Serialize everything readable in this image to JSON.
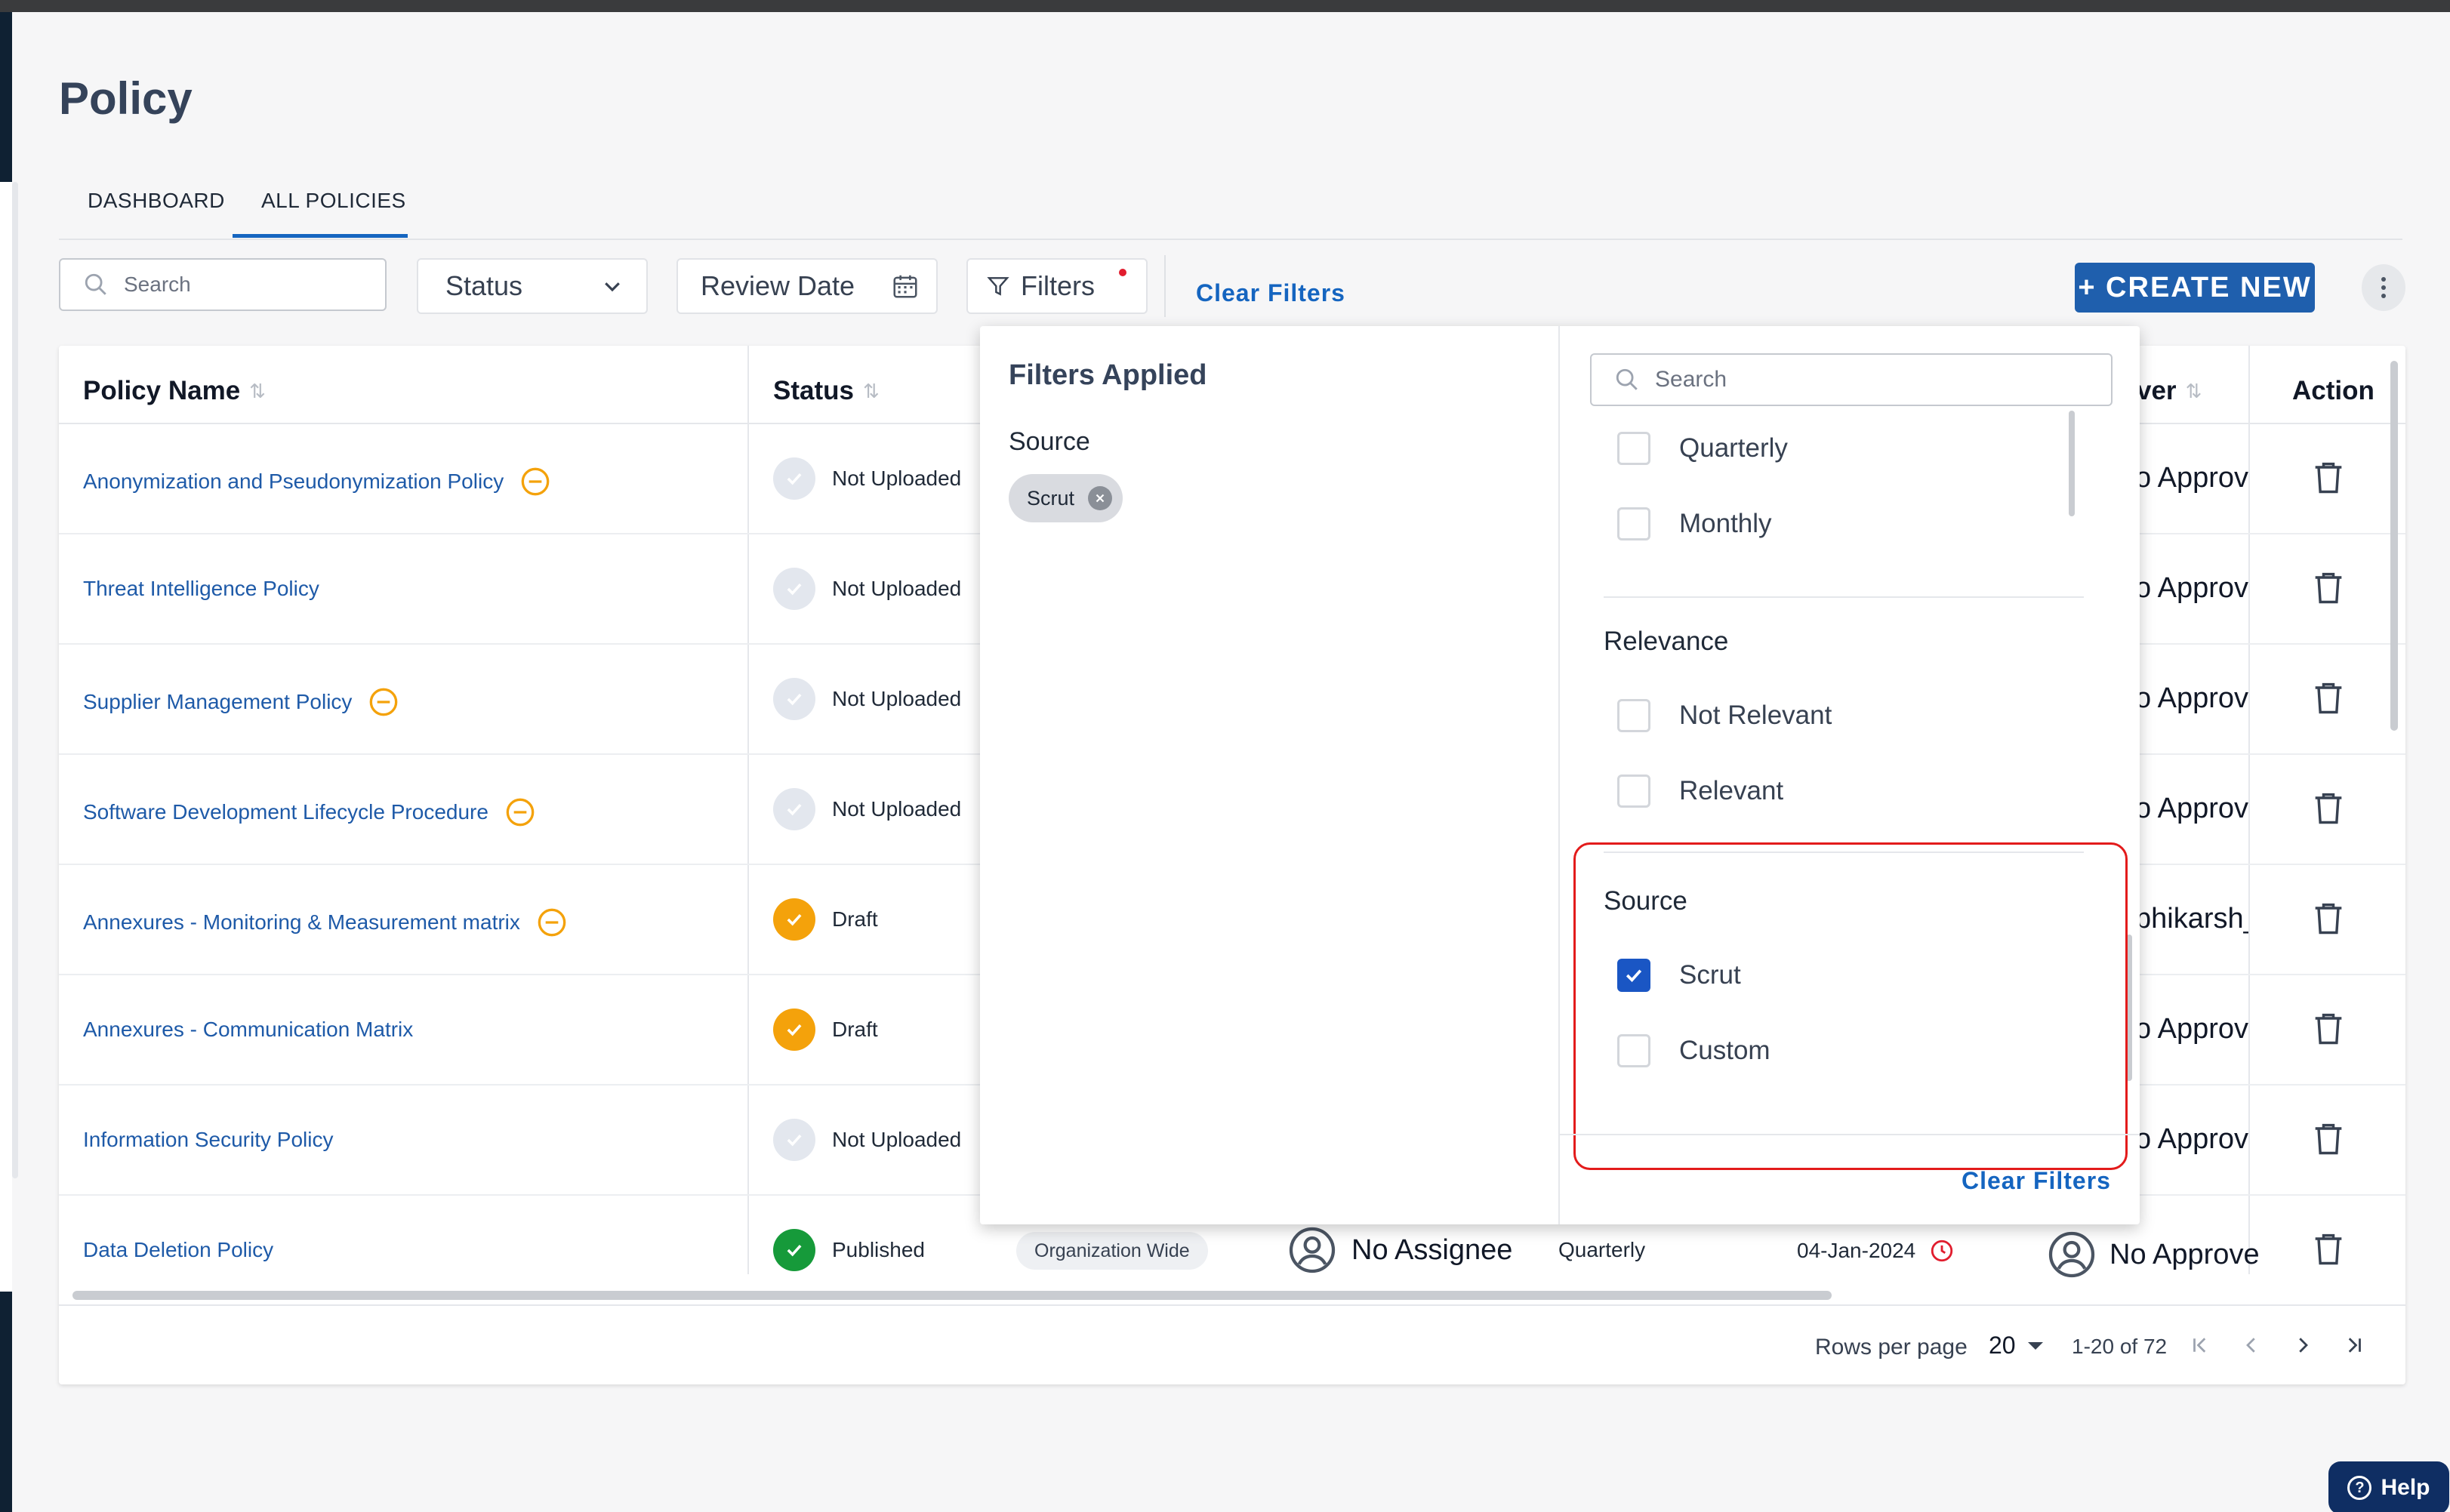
{
  "page": {
    "title": "Policy"
  },
  "tabs": [
    {
      "label": "DASHBOARD"
    },
    {
      "label": "ALL POLICIES"
    }
  ],
  "toolbar": {
    "search_placeholder": "Search",
    "status_label": "Status",
    "review_date_label": "Review Date",
    "filters_label": "Filters",
    "clear_filters_label": "Clear Filters",
    "create_label": "+ CREATE NEW"
  },
  "table": {
    "headers": {
      "policy_name": "Policy Name",
      "status": "Status",
      "approver": "ver",
      "action": "Action"
    },
    "rows": [
      {
        "name": "Anonymization and Pseudonymization Policy",
        "status": "Not Uploaded",
        "approver": "o Approve"
      },
      {
        "name": "Threat Intelligence Policy",
        "status": "Not Uploaded",
        "approver": "o Approve"
      },
      {
        "name": "Supplier Management Policy",
        "status": "Not Uploaded",
        "approver": "o Approve"
      },
      {
        "name": "Software Development Lifecycle Procedure",
        "status": "Not Uploaded",
        "approver": "o Approve"
      },
      {
        "name": "Annexures - Monitoring & Measurement matrix",
        "status": "Draft",
        "approver": "bhikarsh_s"
      },
      {
        "name": "Annexures - Communication Matrix",
        "status": "Draft",
        "approver": "o Approve"
      },
      {
        "name": "Information Security Policy",
        "status": "Not Uploaded",
        "approver": "o Approve"
      },
      {
        "name": "Data Deletion Policy",
        "status": "Published",
        "scope": "Organization Wide",
        "assignee": "No Assignee",
        "frequency": "Quarterly",
        "review_date": "04-Jan-2024",
        "approver": "No Approve"
      }
    ]
  },
  "pagination": {
    "rows_per_page_label": "Rows per page",
    "rows_per_page": "20",
    "range": "1-20 of 72"
  },
  "filters_popup": {
    "title": "Filters Applied",
    "applied_group": "Source",
    "applied_chip": "Scrut",
    "search_placeholder": "Search",
    "frequency_options": [
      "Quarterly",
      "Monthly"
    ],
    "relevance_label": "Relevance",
    "relevance_options": [
      "Not Relevant",
      "Relevant"
    ],
    "source_label": "Source",
    "source_options": [
      {
        "label": "Scrut",
        "checked": true
      },
      {
        "label": "Custom",
        "checked": false
      }
    ],
    "clear_label": "Clear Filters"
  },
  "help": {
    "label": "Help"
  },
  "colors": {
    "accent": "#1565c0",
    "create_button": "#1f5fad",
    "draft": "#f4a20b",
    "published": "#169a3a",
    "highlight": "#e31b1b"
  }
}
